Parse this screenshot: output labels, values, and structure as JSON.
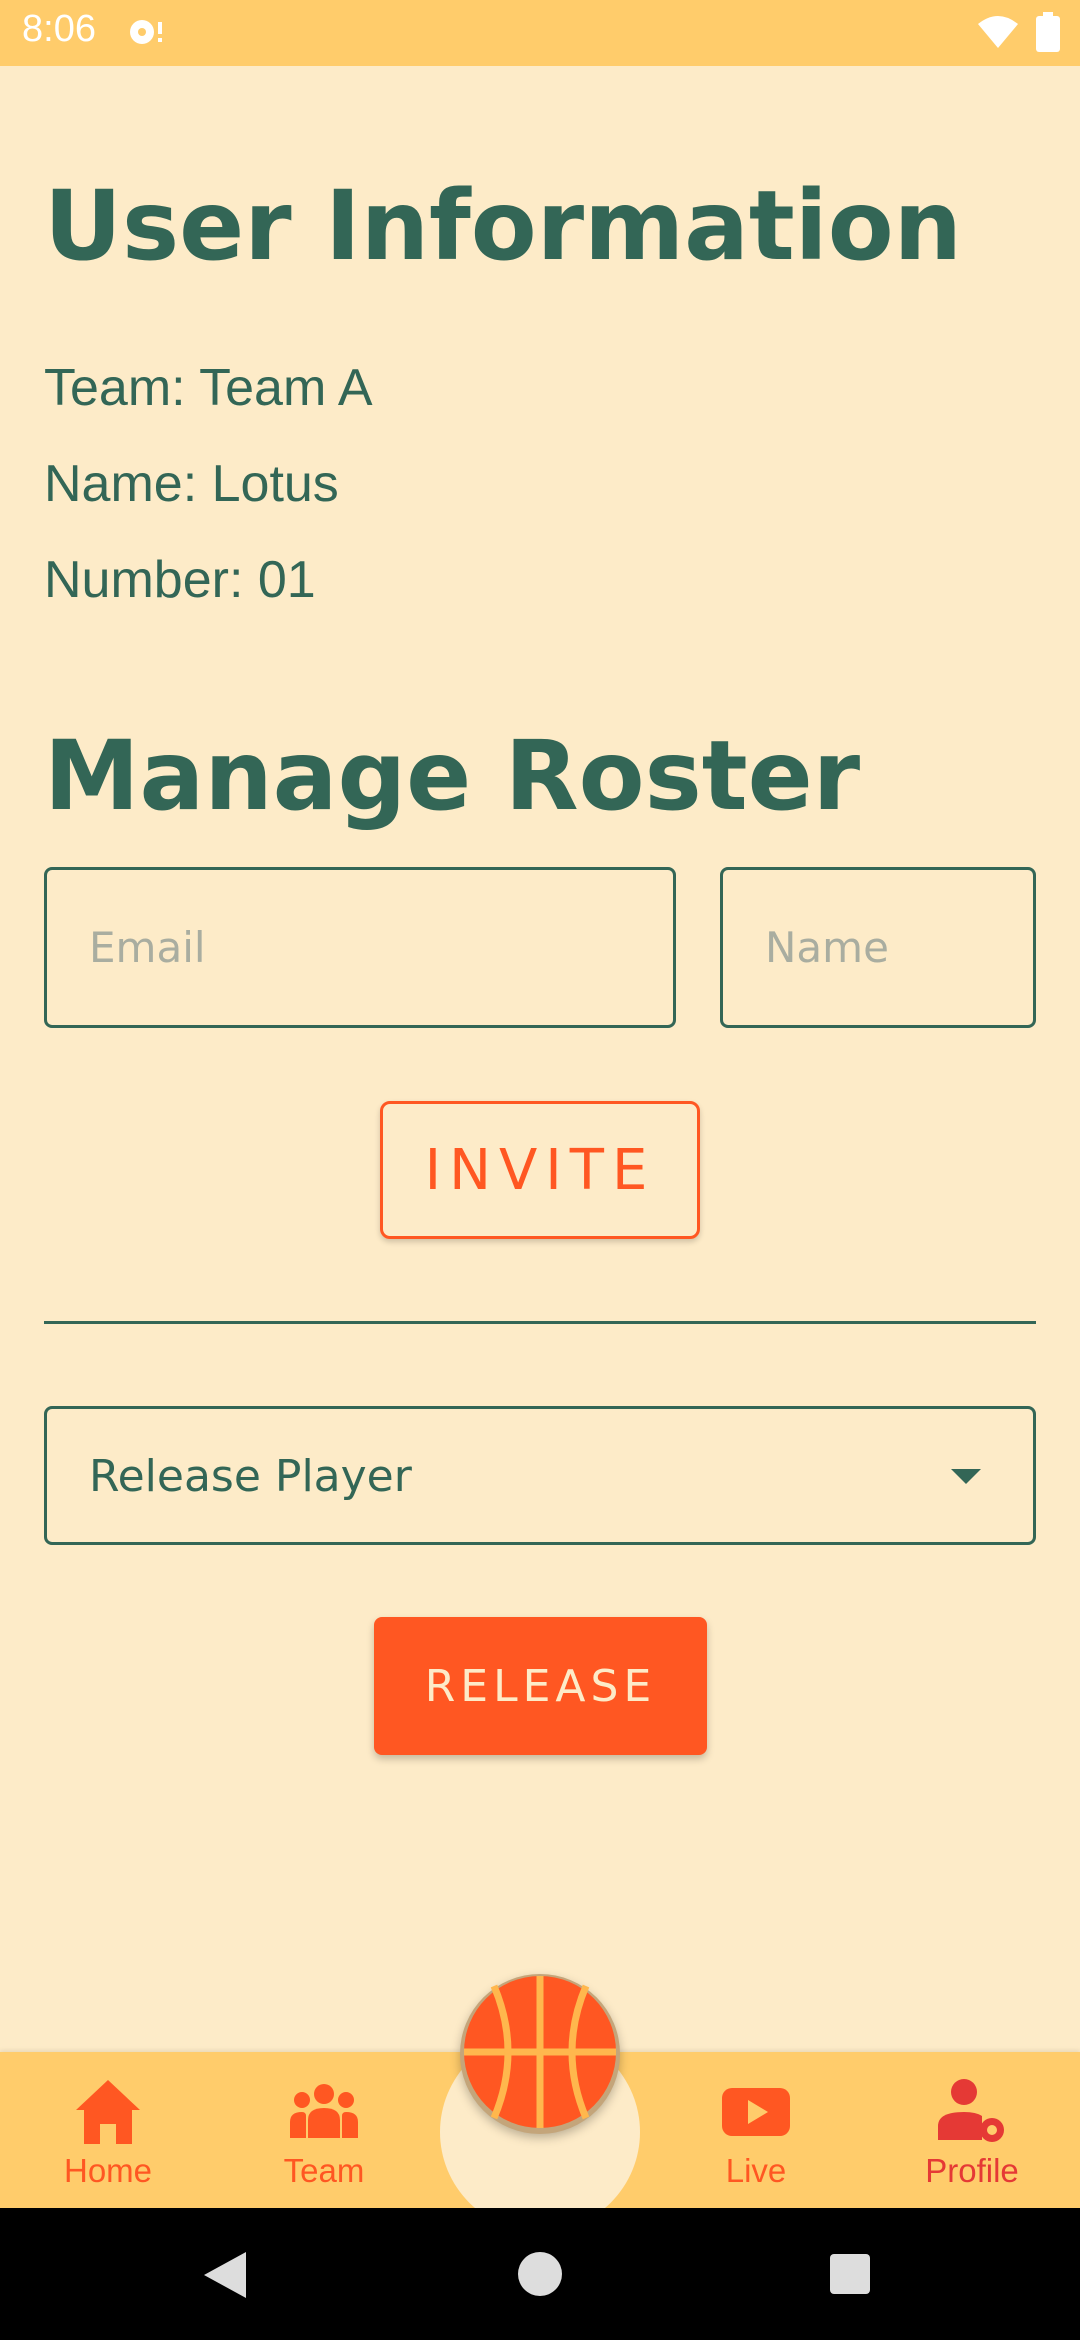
{
  "status_bar": {
    "time": "8:06"
  },
  "user_info": {
    "title": "User Information",
    "team": "Team: Team A",
    "name": "Name: Lotus",
    "number": "Number: 01"
  },
  "roster": {
    "title": "Manage Roster",
    "email_placeholder": "Email",
    "name_placeholder": "Name",
    "invite_label": "INVITE",
    "release_select": "Release Player",
    "release_label": "RELEASE"
  },
  "bottom_nav": {
    "items": [
      {
        "label": "Home",
        "icon": "home-icon"
      },
      {
        "label": "Team",
        "icon": "team-icon"
      },
      {
        "label": "Live",
        "icon": "live-icon"
      },
      {
        "label": "Profile",
        "icon": "profile-settings-icon",
        "active": true
      }
    ],
    "center_icon": "basketball-icon"
  },
  "colors": {
    "background": "#FDEBC8",
    "primary_text": "#336656",
    "accent": "#FF5722",
    "bar": "#FFCC6B"
  }
}
